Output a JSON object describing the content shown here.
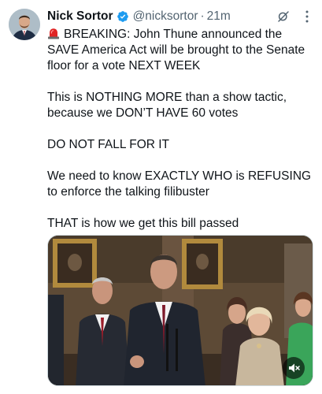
{
  "author": {
    "display_name": "Nick Sortor",
    "handle": "@nicksortor",
    "separator": "·",
    "time": "21m",
    "verified": true
  },
  "tweet": {
    "paragraphs": [
      "BREAKING: John Thune announced the SAVE America Act will be brought to the Senate floor for a vote NEXT WEEK",
      "This is NOTHING MORE than a show tactic, because we DON’T HAVE 60 votes",
      "DO NOT FALL FOR IT",
      "We need to know EXACTLY WHO is REFUSING to enforce the talking filibuster",
      "THAT is how we get this bill passed"
    ],
    "leading_emoji": "siren-icon"
  },
  "media": {
    "type": "video",
    "mute_icon": "speaker-muted-icon"
  },
  "icons": {
    "verified": "verified-badge-icon",
    "grok": "grok-icon",
    "more": "more-options-icon"
  },
  "colors": {
    "text": "#0f1419",
    "secondary": "#536471",
    "verified_blue": "#1d9bf0",
    "border": "#cfd9de"
  }
}
